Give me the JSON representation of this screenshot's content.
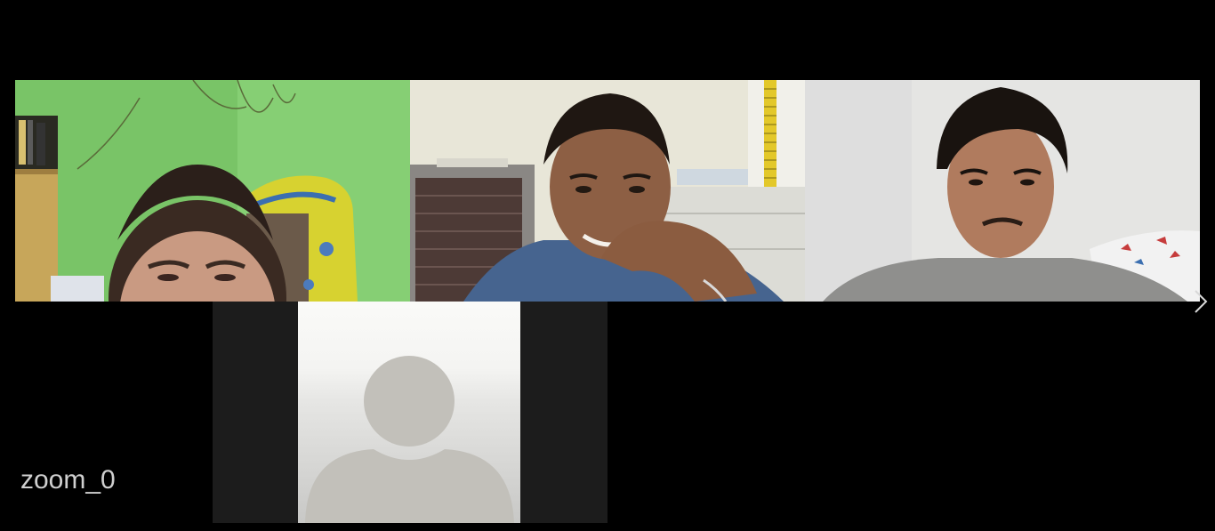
{
  "window": {
    "background": "#000000",
    "label_color": "#cfcfcf"
  },
  "meeting": {
    "name_label": "zoom_0"
  },
  "gallery": {
    "participants": [
      {
        "kind": "video",
        "background": "#7bc46a",
        "icon": "participant-video"
      },
      {
        "kind": "video",
        "background": "#e9e7dc",
        "icon": "participant-video"
      },
      {
        "kind": "video",
        "background": "#e6e6e4",
        "icon": "participant-video"
      },
      {
        "kind": "avatar",
        "background": "#1c1c1c",
        "icon": "default-avatar-icon"
      }
    ],
    "next_page_icon": "chevron-right-icon"
  }
}
